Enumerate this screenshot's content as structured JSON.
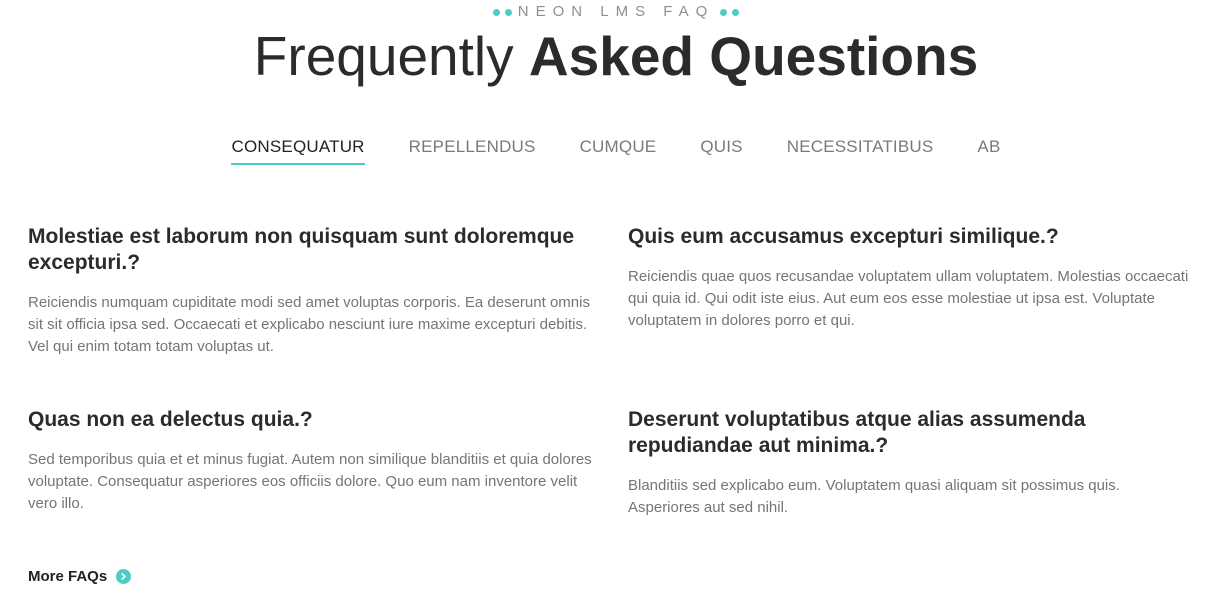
{
  "header": {
    "eyebrow": "NEON LMS FAQ",
    "title_light": "Frequently",
    "title_bold": "Asked Questions"
  },
  "tabs": [
    {
      "label": "CONSEQUATUR",
      "active": true
    },
    {
      "label": "REPELLENDUS",
      "active": false
    },
    {
      "label": "CUMQUE",
      "active": false
    },
    {
      "label": "QUIS",
      "active": false
    },
    {
      "label": "NECESSITATIBUS",
      "active": false
    },
    {
      "label": "AB",
      "active": false
    }
  ],
  "faqs": [
    {
      "question": "Molestiae est laborum non quisquam sunt doloremque excepturi.?",
      "answer": "Reiciendis numquam cupiditate modi sed amet voluptas corporis. Ea deserunt omnis sit sit officia ipsa sed. Occaecati et explicabo nesciunt iure maxime excepturi debitis. Vel qui enim totam totam voluptas ut."
    },
    {
      "question": "Quis eum accusamus excepturi similique.?",
      "answer": "Reiciendis quae quos recusandae voluptatem ullam voluptatem. Molestias occaecati qui quia id. Qui odit iste eius. Aut eum eos esse molestiae ut ipsa est. Voluptate voluptatem in dolores porro et qui."
    },
    {
      "question": "Quas non ea delectus quia.?",
      "answer": "Sed temporibus quia et et minus fugiat. Autem non similique blanditiis et quia dolores voluptate. Consequatur asperiores eos officiis dolore. Quo eum nam inventore velit vero illo."
    },
    {
      "question": "Deserunt voluptatibus atque alias assumenda repudiandae aut minima.?",
      "answer": "Blanditiis sed explicabo eum. Voluptatem quasi aliquam sit possimus quis. Asperiores aut sed nihil."
    }
  ],
  "more_link": {
    "label": "More FAQs",
    "icon": "chevron-right-circle-icon"
  },
  "colors": {
    "accent": "#4ecbc4",
    "heading": "#2b2b2b",
    "body_text": "#757575",
    "tab_inactive": "#7a7a7a"
  }
}
